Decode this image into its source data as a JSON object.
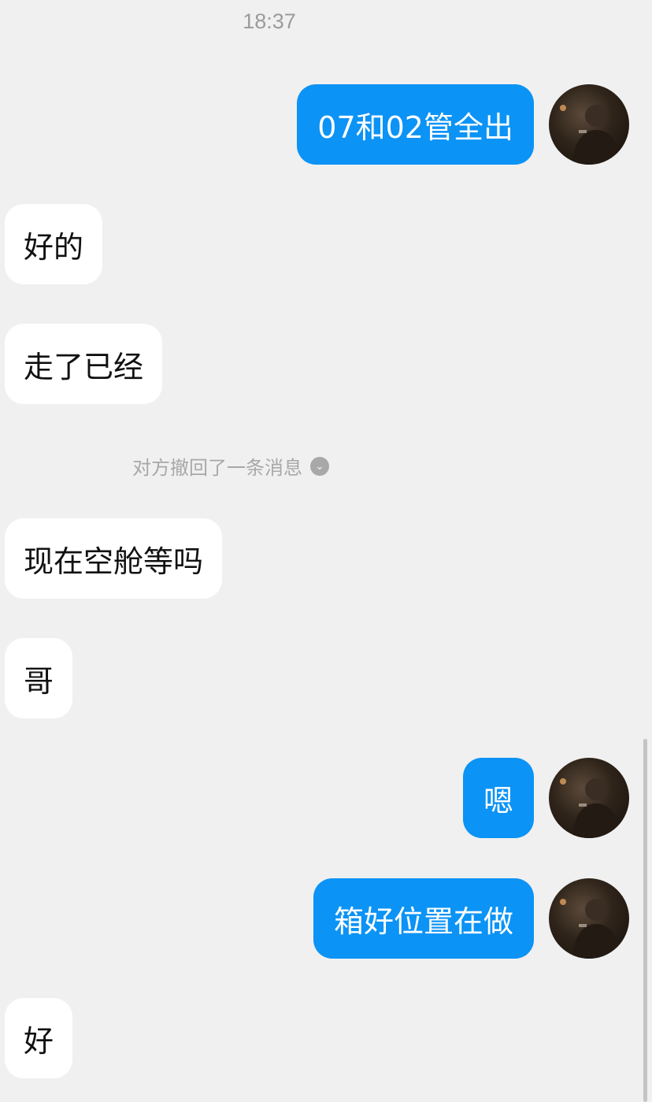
{
  "header": {
    "time": "18:37"
  },
  "messages": [
    {
      "direction": "out",
      "text": "07和02管全出"
    },
    {
      "direction": "in",
      "text": "好的"
    },
    {
      "direction": "in",
      "text": "走了已经"
    },
    {
      "direction": "in",
      "text": "现在空舱等吗"
    },
    {
      "direction": "in",
      "text": "哥"
    },
    {
      "direction": "out",
      "text": "嗯"
    },
    {
      "direction": "out",
      "text": "箱好位置在做"
    },
    {
      "direction": "in",
      "text": "好"
    }
  ],
  "system": {
    "recall_notice": "对方撤回了一条消息"
  },
  "icons": {
    "avatar": "user-avatar-photo",
    "recall": "chevron-down-icon"
  },
  "colors": {
    "background": "#f0f0f0",
    "outgoing_bubble": "#0b93f6",
    "incoming_bubble": "#ffffff"
  }
}
